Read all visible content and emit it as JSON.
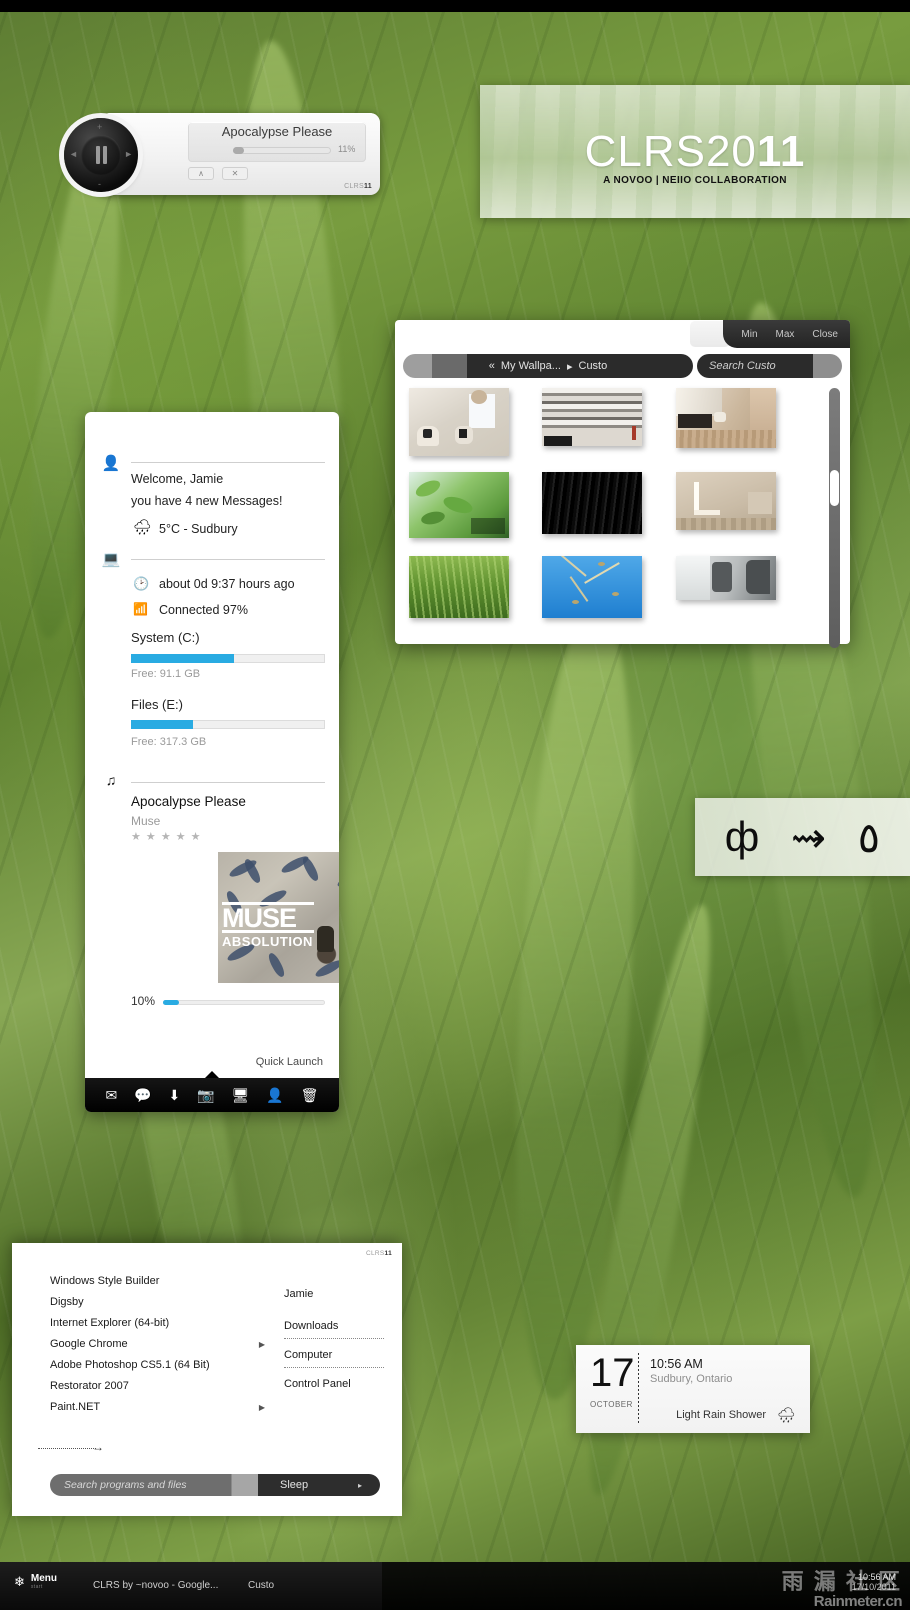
{
  "desktop": {
    "wallpaper_desc": "green-wheat-field"
  },
  "media_player": {
    "title": "Apocalypse Please",
    "progress_label": "11%",
    "progress_value": 11,
    "brand_prefix": "CLRS",
    "brand_suffix": "11",
    "dial": {
      "up": "+",
      "down": "-",
      "left": "◄",
      "right": "►",
      "center_icon": "pause-icon"
    },
    "buttons": [
      {
        "name": "collapse-button",
        "label": "∧"
      },
      {
        "name": "close-button",
        "label": "✕"
      }
    ]
  },
  "banner": {
    "title_light": "CLRS20",
    "title_bold": "11",
    "subtitle": "A NOVOO | NEIIO COLLABORATION"
  },
  "sidebar": {
    "user": {
      "icon": "user-icon",
      "welcome": "Welcome, Jamie",
      "messages": "you have 4 new Messages!"
    },
    "weather": {
      "icon": "rain-cloud-icon",
      "text": "5°C - Sudbury"
    },
    "system": {
      "icon": "monitor-icon",
      "uptime": {
        "icon": "clock-icon",
        "text": "about 0d 9:37 hours ago"
      },
      "network": {
        "icon": "wifi-icon",
        "text": "Connected 97%"
      }
    },
    "drives": [
      {
        "label": "System (C:)",
        "free": "Free: 91.1 GB",
        "used_pct": 53
      },
      {
        "label": "Files (E:)",
        "free": "Free: 317.3 GB",
        "used_pct": 32
      }
    ],
    "music": {
      "icon": "music-note-icon",
      "track": "Apocalypse Please",
      "artist": "Muse",
      "rating": "★ ★ ★ ★ ★",
      "album_art": {
        "band": "MUSE",
        "album": "ABSOLUTION"
      },
      "progress_label": "10%",
      "progress_value": 10
    },
    "quick_launch": {
      "label": "Quick Launch",
      "items": [
        {
          "name": "mail-icon",
          "glyph": "✉"
        },
        {
          "name": "chat-icon",
          "glyph": "💬"
        },
        {
          "name": "download-icon",
          "glyph": "⬇"
        },
        {
          "name": "camera-icon",
          "glyph": "📷"
        },
        {
          "name": "monitor-icon",
          "glyph": "🖥"
        },
        {
          "name": "user-icon",
          "glyph": "👤"
        },
        {
          "name": "trash-icon",
          "glyph": "🗑"
        }
      ]
    }
  },
  "explorer": {
    "window_buttons": [
      {
        "name": "minimize-button",
        "label": "Min"
      },
      {
        "name": "maximize-button",
        "label": "Max"
      },
      {
        "name": "close-button",
        "label": "Close"
      }
    ],
    "breadcrumb": {
      "back": "«",
      "segment1": "My Wallpa...",
      "sep": "▸",
      "segment2": "Custo"
    },
    "search_placeholder": "Search Custo",
    "thumbnails": [
      {
        "name": "thumb-white-room"
      },
      {
        "name": "thumb-striped-ceiling"
      },
      {
        "name": "thumb-wood-interior"
      },
      {
        "name": "thumb-green-leaves"
      },
      {
        "name": "thumb-black-texture"
      },
      {
        "name": "thumb-beige-corner"
      },
      {
        "name": "thumb-wheat-field"
      },
      {
        "name": "thumb-blue-sky-grass"
      },
      {
        "name": "thumb-grey-structure"
      }
    ]
  },
  "glyph_widget": {
    "glyphs": [
      "ф",
      "⇝",
      "٥"
    ]
  },
  "start_menu": {
    "brand_prefix": "CLRS",
    "brand_suffix": "11",
    "programs": [
      {
        "label": "Windows Style Builder",
        "submenu": false
      },
      {
        "label": "Digsby",
        "submenu": false
      },
      {
        "label": "Internet Explorer (64-bit)",
        "submenu": false
      },
      {
        "label": "Google Chrome",
        "submenu": true
      },
      {
        "label": "Adobe Photoshop CS5.1 (64 Bit)",
        "submenu": false
      },
      {
        "label": "Restorator 2007",
        "submenu": false
      },
      {
        "label": "Paint.NET",
        "submenu": true
      }
    ],
    "places": [
      "Jamie",
      "Downloads",
      "Computer",
      "Control Panel"
    ],
    "all_programs_arrow": "→",
    "search_placeholder": "Search programs and files",
    "sleep_label": "Sleep",
    "sleep_arrow": "▸"
  },
  "clock_widget": {
    "day": "17",
    "month": "OCTOBER",
    "time": "10:56 AM",
    "location": "Sudbury, Ontario",
    "condition": "Light Rain Shower",
    "condition_icon": "rain-cloud-icon"
  },
  "taskbar": {
    "menu_label": "Menu",
    "menu_sub": "start",
    "tasks": [
      "CLRS by ~novoo - Google...",
      "Custo"
    ],
    "time": "10:56 AM",
    "date": "17/10/2011",
    "watermark_cn": "雨 漏 社 区",
    "watermark_en": "Rainmeter.cn"
  },
  "colors": {
    "accent_blue": "#29abe2",
    "dark_chrome": "#1f1f1f",
    "panel_white": "#ffffff"
  }
}
